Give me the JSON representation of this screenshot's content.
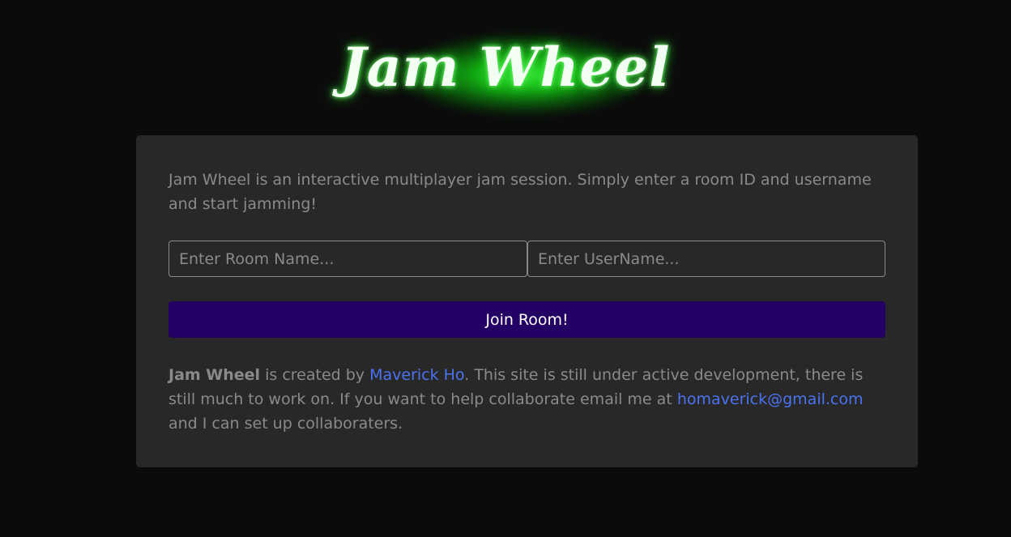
{
  "header": {
    "title": "Jam Wheel"
  },
  "card": {
    "intro": "Jam Wheel is an interactive multiplayer jam session. Simply enter a room ID and username and start jamming!",
    "room_input": {
      "value": "",
      "placeholder": "Enter Room Name..."
    },
    "user_input": {
      "value": "",
      "placeholder": "Enter UserName..."
    },
    "join_button": "Join Room!",
    "footer": {
      "brand": "Jam Wheel",
      "text1": " is created by ",
      "author_link": "Maverick Ho",
      "text2": ". This site is still under active development, there is still much to work on. If you want to help collaborate email me at ",
      "email_link": "homaverick@gmail.com",
      "text3": " and I can set up collaboraters."
    }
  },
  "colors": {
    "background": "#0b0b0b",
    "card": "#282828",
    "title_glow": "#22d622",
    "button": "#230063",
    "link": "#4b73f0",
    "muted_text": "#8a8a8a"
  }
}
